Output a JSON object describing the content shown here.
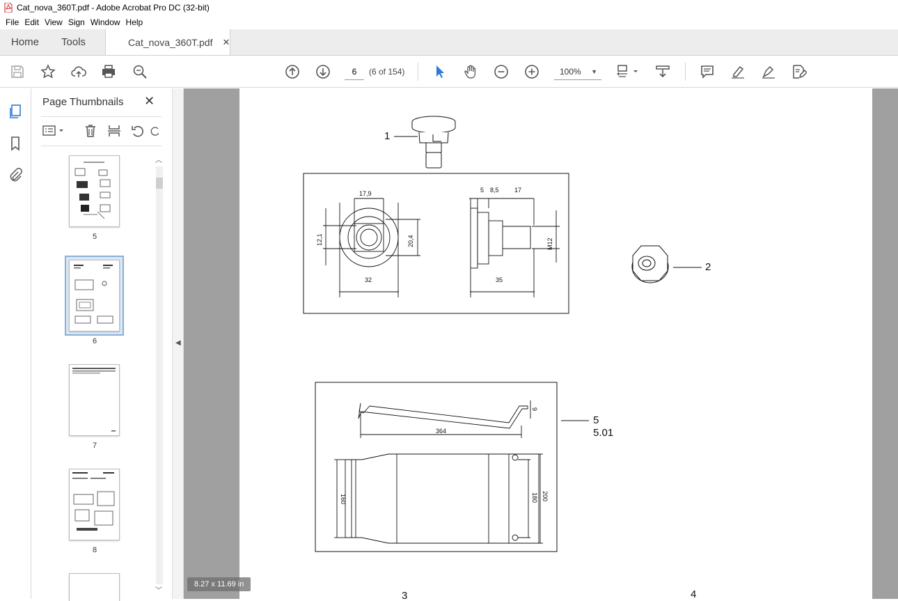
{
  "window": {
    "title": "Cat_nova_360T.pdf - Adobe Acrobat Pro DC (32-bit)"
  },
  "menu": [
    "File",
    "Edit",
    "View",
    "Sign",
    "Window",
    "Help"
  ],
  "tabs": {
    "home": "Home",
    "tools": "Tools",
    "document": "Cat_nova_360T.pdf"
  },
  "toolbar": {
    "page_value": "6",
    "page_count": "(6 of 154)",
    "zoom": "100%"
  },
  "thumbnails": {
    "title": "Page Thumbnails",
    "pages": [
      {
        "label": "5",
        "selected": false
      },
      {
        "label": "6",
        "selected": true
      },
      {
        "label": "7",
        "selected": false
      },
      {
        "label": "8",
        "selected": false
      }
    ]
  },
  "document": {
    "labels": {
      "item1": "1",
      "item2": "2",
      "item5": "5",
      "item501": "5.01",
      "item3": "3",
      "item4": "4"
    },
    "dims": {
      "d1": "17,9",
      "d2": "12,1",
      "d3": "20,4",
      "d4": "32",
      "d5": "5",
      "d6": "8,5",
      "d7": "17",
      "d8": "M12",
      "d9": "35",
      "d10": "364",
      "d11": "9",
      "d12": "160",
      "d13": "180",
      "d14": "200"
    },
    "page_size": "8.27 x 11.69 in"
  },
  "colors": {
    "accent_blue": "#2d7ad6",
    "toolbar_icon": "#555555",
    "pdf_red": "#d71f1f"
  }
}
